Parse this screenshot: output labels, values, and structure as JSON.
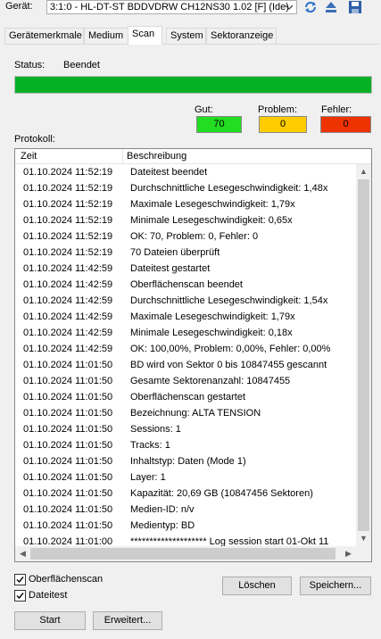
{
  "device": {
    "label": "Gerät:",
    "selected": "3:1:0 - HL-DT-ST BDDVDRW CH12NS30 1.02 [F] (Ide)"
  },
  "toolbar_icons": [
    "refresh-icon",
    "eject-icon",
    "save-icon"
  ],
  "tabs": [
    {
      "label": "Gerätemerkmale",
      "active": false
    },
    {
      "label": "Medium",
      "active": false
    },
    {
      "label": "Scan",
      "active": true
    },
    {
      "label": "System",
      "active": false
    },
    {
      "label": "Sektoranzeige",
      "active": false
    }
  ],
  "status": {
    "label": "Status:",
    "value": "Beendet",
    "progress": 1.0,
    "progress_color": "#06b025"
  },
  "counts": {
    "good_label": "Gut:",
    "good_value": "70",
    "good_color": "#22dd22",
    "problem_label": "Problem:",
    "problem_value": "0",
    "problem_color": "#ffcc00",
    "error_label": "Fehler:",
    "error_value": "0",
    "error_color": "#ee3300"
  },
  "log": {
    "label": "Protokoll:",
    "columns": [
      "Zeit",
      "Beschreibung"
    ],
    "rows": [
      {
        "time": "01.10.2024 11:52:19",
        "desc": "Dateitest beendet"
      },
      {
        "time": "01.10.2024 11:52:19",
        "desc": "Durchschnittliche Lesegeschwindigkeit: 1,48x"
      },
      {
        "time": "01.10.2024 11:52:19",
        "desc": "Maximale Lesegeschwindigkeit: 1,79x"
      },
      {
        "time": "01.10.2024 11:52:19",
        "desc": "Minimale Lesegeschwindigkeit: 0,65x"
      },
      {
        "time": "01.10.2024 11:52:19",
        "desc": "OK: 70, Problem: 0, Fehler: 0"
      },
      {
        "time": "01.10.2024 11:52:19",
        "desc": "70 Dateien überprüft"
      },
      {
        "time": "01.10.2024 11:42:59",
        "desc": "Dateitest gestartet"
      },
      {
        "time": "01.10.2024 11:42:59",
        "desc": "Oberflächenscan beendet"
      },
      {
        "time": "01.10.2024 11:42:59",
        "desc": "Durchschnittliche Lesegeschwindigkeit: 1,54x"
      },
      {
        "time": "01.10.2024 11:42:59",
        "desc": "Maximale Lesegeschwindigkeit: 1,79x"
      },
      {
        "time": "01.10.2024 11:42:59",
        "desc": "Minimale Lesegeschwindigkeit: 0,18x"
      },
      {
        "time": "01.10.2024 11:42:59",
        "desc": "OK: 100,00%, Problem: 0,00%, Fehler: 0,00%"
      },
      {
        "time": "01.10.2024 11:01:50",
        "desc": "BD wird von Sektor 0 bis 10847455 gescannt"
      },
      {
        "time": "01.10.2024 11:01:50",
        "desc": "Gesamte Sektorenanzahl: 10847455"
      },
      {
        "time": "01.10.2024 11:01:50",
        "desc": "Oberflächenscan gestartet"
      },
      {
        "time": "01.10.2024 11:01:50",
        "desc": "Bezeichnung: ALTA TENSION"
      },
      {
        "time": "01.10.2024 11:01:50",
        "desc": "Sessions: 1"
      },
      {
        "time": "01.10.2024 11:01:50",
        "desc": "Tracks: 1"
      },
      {
        "time": "01.10.2024 11:01:50",
        "desc": "Inhaltstyp: Daten (Mode 1)"
      },
      {
        "time": "01.10.2024 11:01:50",
        "desc": "Layer: 1"
      },
      {
        "time": "01.10.2024 11:01:50",
        "desc": "Kapazität: 20,69 GB (10847456 Sektoren)"
      },
      {
        "time": "01.10.2024 11:01:50",
        "desc": "Medien-ID: n/v"
      },
      {
        "time": "01.10.2024 11:01:50",
        "desc": "Medientyp: BD"
      },
      {
        "time": "01.10.2024 11:01:00",
        "desc": "******************** Log session start 01-Okt 11"
      }
    ]
  },
  "options": {
    "surface_scan_label": "Oberflächenscan",
    "surface_scan_checked": true,
    "file_test_label": "Dateitest",
    "file_test_checked": true
  },
  "buttons": {
    "clear": "Löschen",
    "save": "Speichern...",
    "start": "Start",
    "extended": "Erweitert..."
  }
}
